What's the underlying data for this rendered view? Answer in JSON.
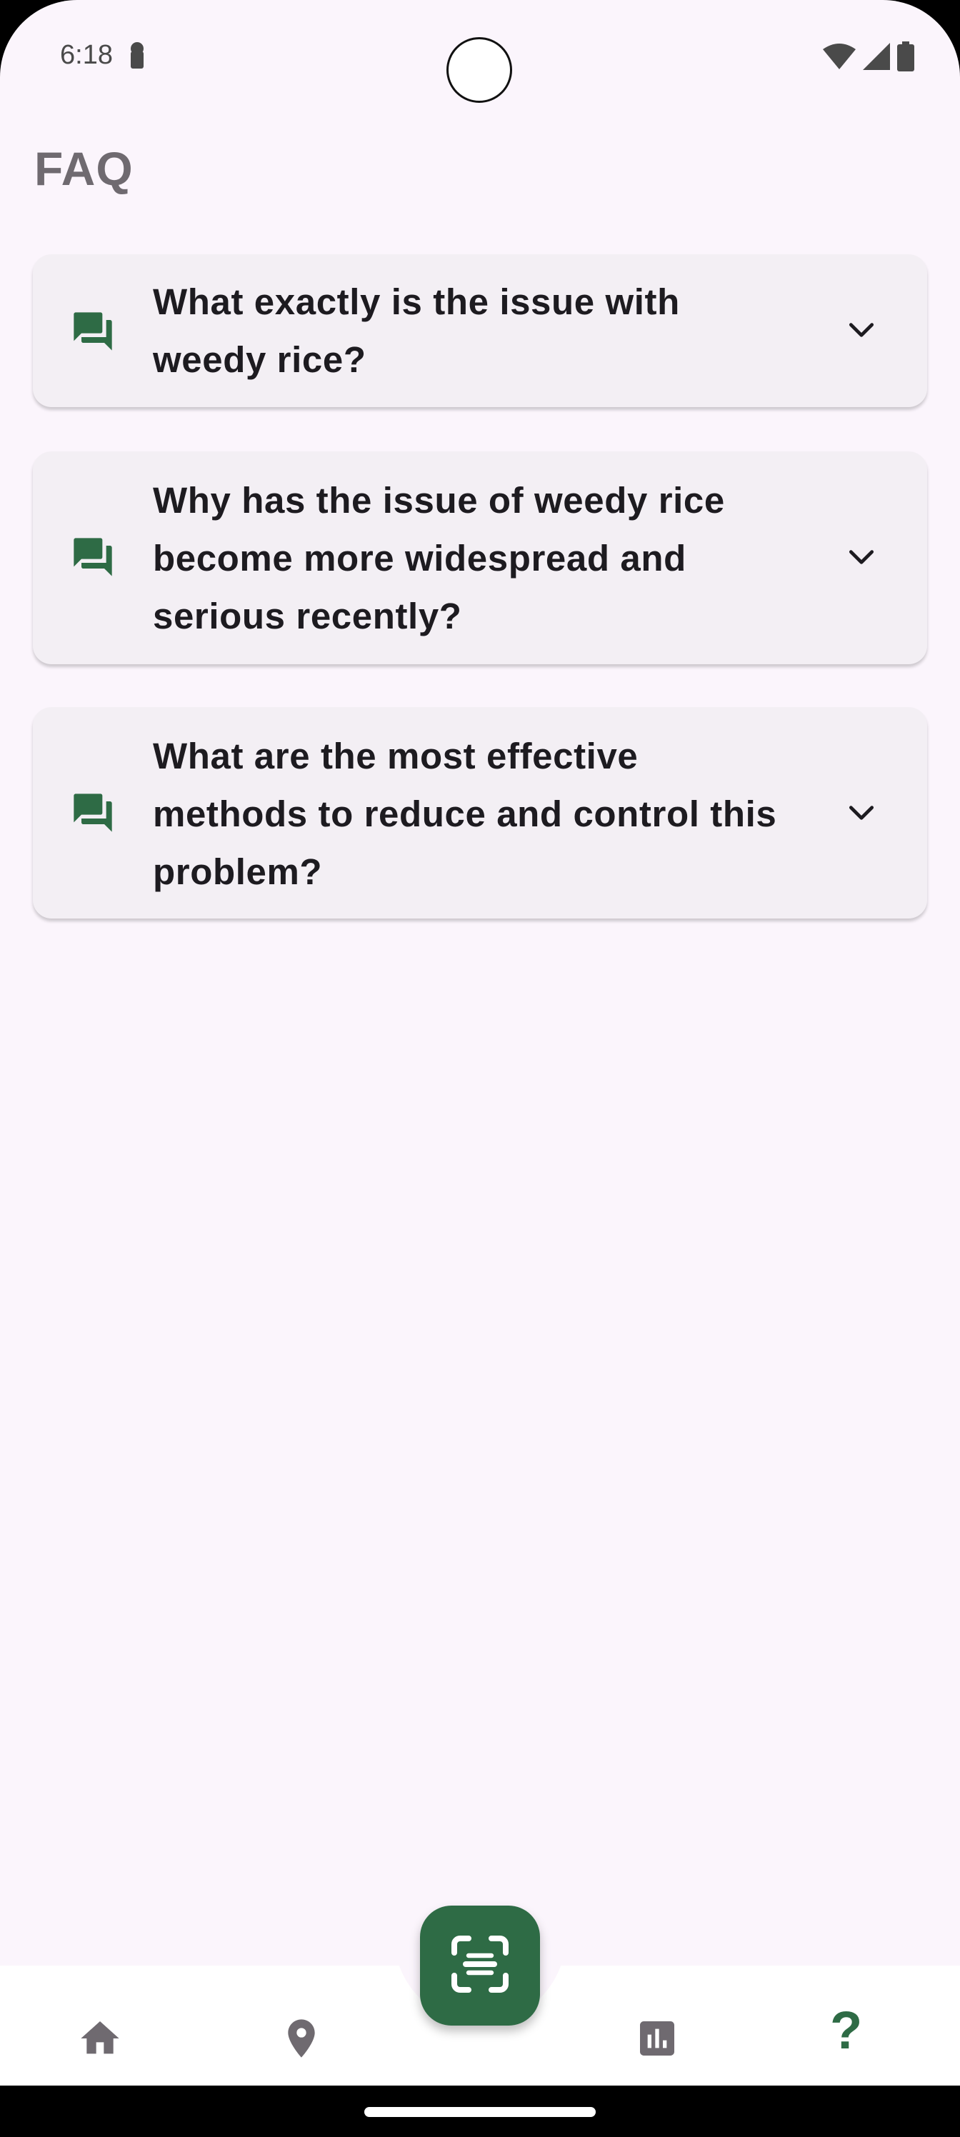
{
  "status_bar": {
    "time": "6:18",
    "icons": [
      "lock-icon",
      "wifi-icon",
      "signal-icon",
      "battery-icon"
    ]
  },
  "page": {
    "title": "FAQ"
  },
  "faqs": [
    {
      "question": "What exactly is the issue with weedy rice?",
      "icon": "chat-icon",
      "expand_icon": "chevron-down-icon"
    },
    {
      "question": "Why has the issue of weedy rice become more widespread and serious recently?",
      "icon": "chat-icon",
      "expand_icon": "chevron-down-icon"
    },
    {
      "question": "What are the most effective methods to reduce and control this problem?",
      "icon": "chat-icon",
      "expand_icon": "chevron-down-icon"
    }
  ],
  "bottom_nav": {
    "items": [
      {
        "icon": "home-icon"
      },
      {
        "icon": "location-pin-icon"
      },
      {
        "icon": "scan-icon"
      },
      {
        "icon": "bar-chart-icon"
      },
      {
        "icon": "help-icon",
        "label": "?"
      }
    ],
    "active": "help-icon"
  },
  "colors": {
    "background": "#FBF5FC",
    "card": "#F3EFF4",
    "accent": "#2E6B45",
    "text": "#1D1B20",
    "title": "#6F6A70"
  }
}
